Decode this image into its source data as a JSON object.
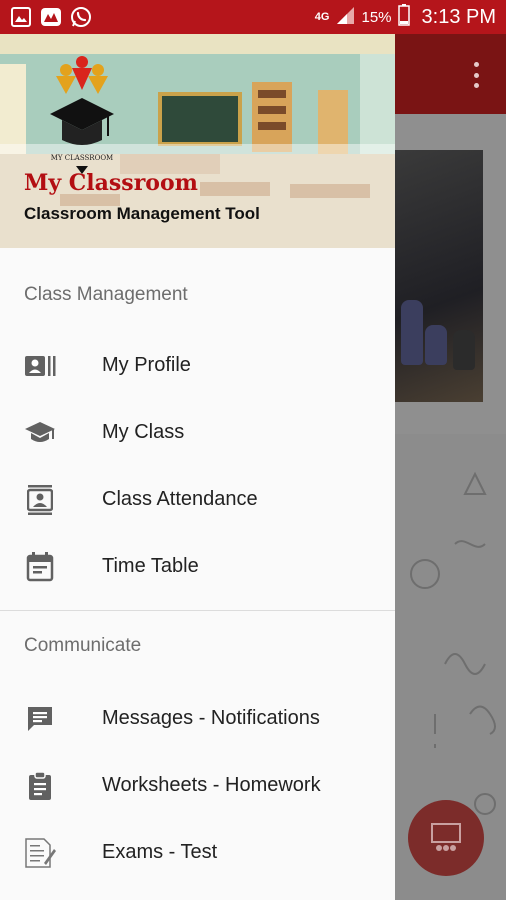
{
  "status_bar": {
    "network": "4G",
    "battery": "15%",
    "time": "3:13 PM"
  },
  "drawer": {
    "header": {
      "title": "My Classroom",
      "subtitle": "Classroom Management Tool",
      "logo_text": "MY CLASSROOM"
    },
    "sections": [
      {
        "title": "Class Management",
        "items": [
          {
            "label": "My Profile",
            "icon": "profile-card-icon"
          },
          {
            "label": "My Class",
            "icon": "graduation-cap-icon"
          },
          {
            "label": "Class Attendance",
            "icon": "attendance-badge-icon"
          },
          {
            "label": "Time Table",
            "icon": "calendar-icon"
          }
        ]
      },
      {
        "title": "Communicate",
        "items": [
          {
            "label": "Messages - Notifications",
            "icon": "message-icon"
          },
          {
            "label": "Worksheets - Homework",
            "icon": "clipboard-icon"
          },
          {
            "label": "Exams - Test",
            "icon": "exam-paper-icon"
          }
        ]
      }
    ]
  },
  "colors": {
    "status_bar": "#b5151b",
    "title_red": "#b30e12",
    "icon_grey": "#616161"
  }
}
